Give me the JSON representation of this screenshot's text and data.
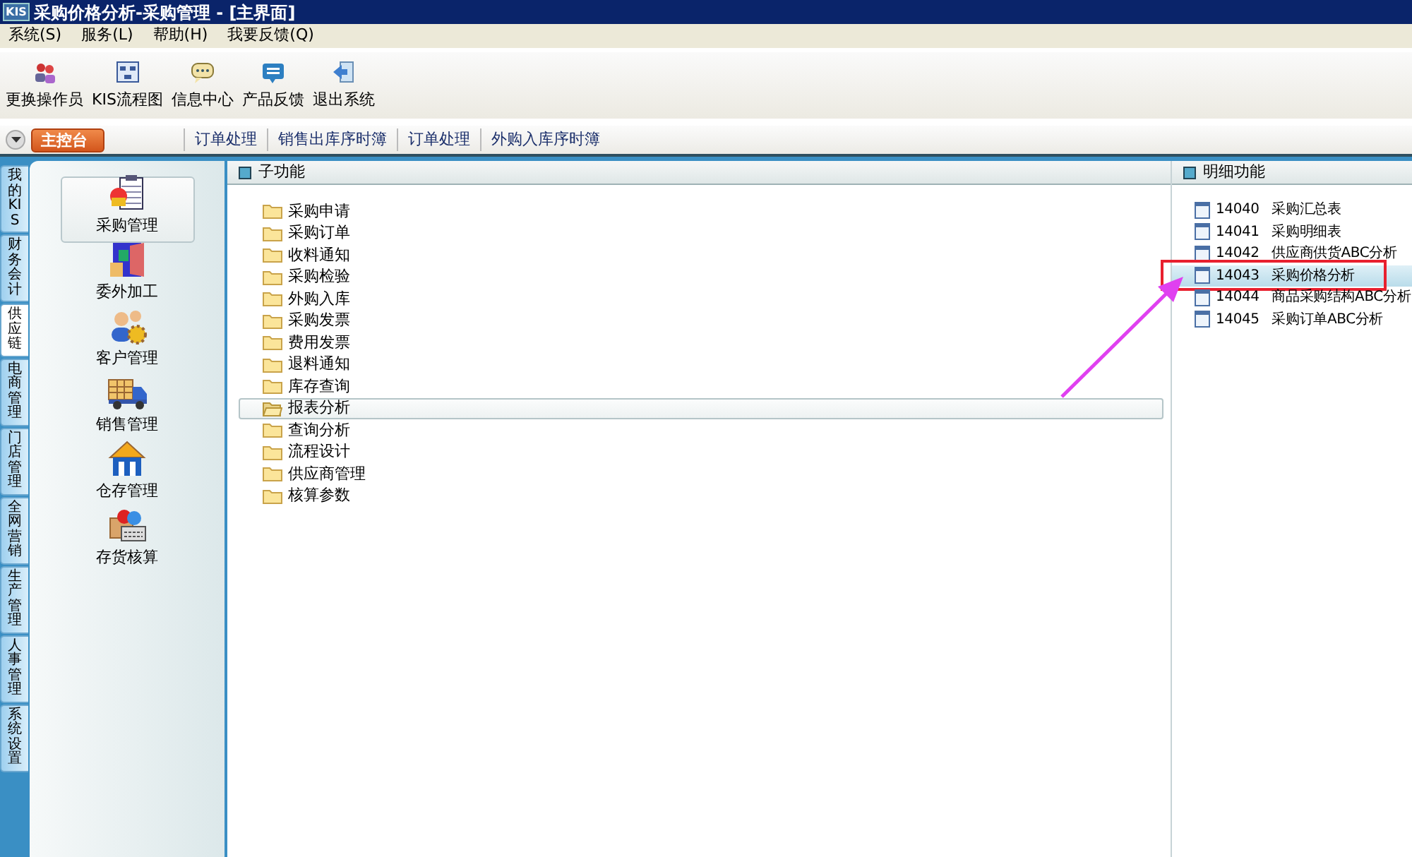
{
  "window": {
    "logo": "KIS",
    "title": "采购价格分析-采购管理 - [主界面]"
  },
  "menu": [
    "系统(S)",
    "服务(L)",
    "帮助(H)",
    "我要反馈(Q)"
  ],
  "toolbar": [
    "更换操作员",
    "KIS流程图",
    "信息中心",
    "产品反馈",
    "退出系统"
  ],
  "tab_bar": {
    "main_tab": "主控台",
    "tabs": [
      "订单处理",
      "销售出库序时簿",
      "订单处理",
      "外购入库序时簿"
    ]
  },
  "side_tabs": [
    {
      "label": "我的KIS",
      "selected": false
    },
    {
      "label": "财务会计",
      "selected": false
    },
    {
      "label": "供应链",
      "selected": true
    },
    {
      "label": "电商管理",
      "selected": false
    },
    {
      "label": "门店管理",
      "selected": false
    },
    {
      "label": "全网营销",
      "selected": false
    },
    {
      "label": "生产管理",
      "selected": false
    },
    {
      "label": "人事管理",
      "selected": false
    },
    {
      "label": "系统设置",
      "selected": false
    }
  ],
  "modules": [
    {
      "label": "采购管理",
      "selected": true
    },
    {
      "label": "委外加工",
      "selected": false
    },
    {
      "label": "客户管理",
      "selected": false
    },
    {
      "label": "销售管理",
      "selected": false
    },
    {
      "label": "仓存管理",
      "selected": false
    },
    {
      "label": "存货核算",
      "selected": false
    }
  ],
  "sub_functions": {
    "title": "子功能",
    "items": [
      {
        "label": "采购申请",
        "selected": false
      },
      {
        "label": "采购订单",
        "selected": false
      },
      {
        "label": "收料通知",
        "selected": false
      },
      {
        "label": "采购检验",
        "selected": false
      },
      {
        "label": "外购入库",
        "selected": false
      },
      {
        "label": "采购发票",
        "selected": false
      },
      {
        "label": "费用发票",
        "selected": false
      },
      {
        "label": "退料通知",
        "selected": false
      },
      {
        "label": "库存查询",
        "selected": false
      },
      {
        "label": "报表分析",
        "selected": true
      },
      {
        "label": "查询分析",
        "selected": false
      },
      {
        "label": "流程设计",
        "selected": false
      },
      {
        "label": "供应商管理",
        "selected": false
      },
      {
        "label": "核算参数",
        "selected": false
      }
    ]
  },
  "detail_functions": {
    "title": "明细功能",
    "items": [
      {
        "code": "14040",
        "name": "采购汇总表",
        "selected": false,
        "annotated": false
      },
      {
        "code": "14041",
        "name": "采购明细表",
        "selected": false,
        "annotated": false
      },
      {
        "code": "14042",
        "name": "供应商供货ABC分析",
        "selected": false,
        "annotated": false
      },
      {
        "code": "14043",
        "name": "采购价格分析",
        "selected": true,
        "annotated": true
      },
      {
        "code": "14044",
        "name": "商品采购结构ABC分析",
        "selected": false,
        "annotated": false
      },
      {
        "code": "14045",
        "name": "采购订单ABC分析",
        "selected": false,
        "annotated": false
      }
    ]
  }
}
